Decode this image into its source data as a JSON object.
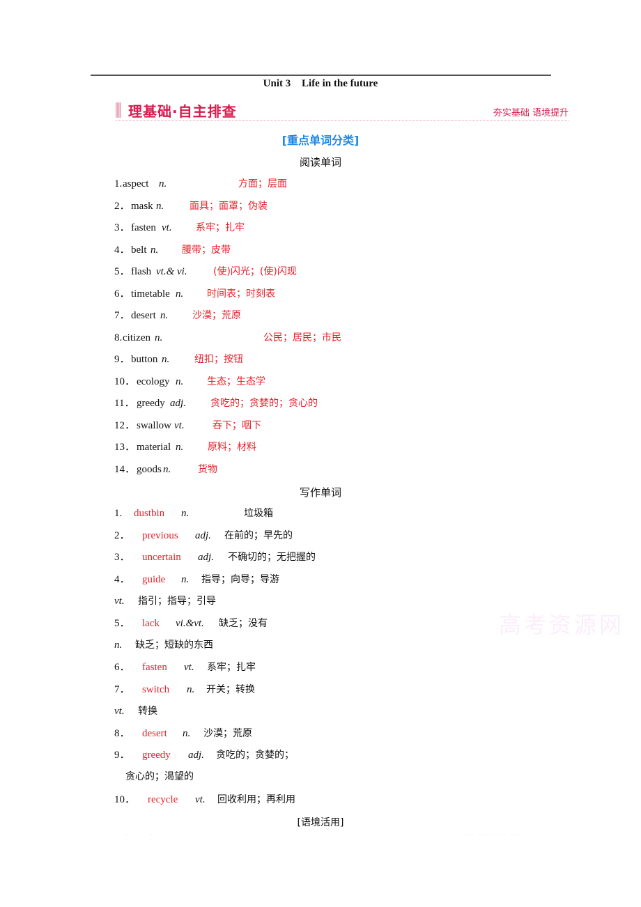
{
  "header": {
    "unit": "Unit 3",
    "title": "Life in the future"
  },
  "section": {
    "title": "理基础·自主排查",
    "tagline": "夯实基础  语境提升"
  },
  "category_title": "[重点单词分类]",
  "reading": {
    "title": "阅读单词",
    "items": [
      {
        "num": "1.",
        "word": "aspect",
        "pos": "n.",
        "meaning": "方面；层面"
      },
      {
        "num": "2．",
        "word": "mask",
        "pos": "n.",
        "meaning": "面具；面罩；伪装"
      },
      {
        "num": "3．",
        "word": "fasten",
        "pos": "vt.",
        "meaning": "系牢；扎牢"
      },
      {
        "num": "4．",
        "word": "belt",
        "pos": "n.",
        "meaning": "腰带；皮带"
      },
      {
        "num": "5．",
        "word": "flash",
        "pos": "vt.& vi.",
        "meaning": "(使)闪光；(使)闪现"
      },
      {
        "num": "6．",
        "word": "timetable",
        "pos": "n.",
        "meaning": "时间表；时刻表"
      },
      {
        "num": "7．",
        "word": "desert",
        "pos": "n.",
        "meaning": "沙漠；荒原"
      },
      {
        "num": "8.",
        "word": "citizen",
        "pos": "n.",
        "meaning": "公民；居民；市民"
      },
      {
        "num": "9．",
        "word": "button",
        "pos": "n.",
        "meaning": "纽扣；按钮"
      },
      {
        "num": "10．",
        "word": "ecology",
        "pos": "n.",
        "meaning": "生态；生态学"
      },
      {
        "num": "11．",
        "word": "greedy",
        "pos": "adj.",
        "meaning": "贪吃的；贪婪的；贪心的"
      },
      {
        "num": "12．",
        "word": "swallow",
        "pos": "vt.",
        "meaning": "吞下；咽下"
      },
      {
        "num": "13．",
        "word": "material",
        "pos": "n.",
        "meaning": "原料；材料"
      },
      {
        "num": "14．",
        "word": "goods",
        "pos": "n.",
        "meaning": "货物"
      }
    ]
  },
  "writing": {
    "title": "写作单词",
    "items": [
      {
        "num": "1.",
        "word": "dustbin",
        "pos": "n.",
        "meaning": "垃圾箱"
      },
      {
        "num": "2．",
        "word": "previous",
        "pos": "adj.",
        "meaning": "在前的；早先的"
      },
      {
        "num": "3．",
        "word": "uncertain",
        "pos": "adj.",
        "meaning": "不确切的；无把握的"
      },
      {
        "num": "4．",
        "word": "guide",
        "pos": "n.",
        "meaning": "指导；向导；导游"
      },
      {
        "num": "",
        "word": "",
        "pos": "vt.",
        "meaning": "指引；指导；引导"
      },
      {
        "num": "5．",
        "word": "lack",
        "pos": "vi.&vt.",
        "meaning": "缺乏；没有"
      },
      {
        "num": "",
        "word": "",
        "pos": "n.",
        "meaning": "缺乏；短缺的东西"
      },
      {
        "num": "6．",
        "word": "fasten",
        "pos": "vt.",
        "meaning": "系牢；扎牢"
      },
      {
        "num": "7．",
        "word": "switch",
        "pos": "n.",
        "meaning": "开关；转换"
      },
      {
        "num": "",
        "word": "",
        "pos": "vt.",
        "meaning": "转换"
      },
      {
        "num": "8．",
        "word": "desert",
        "pos": "n.",
        "meaning": "沙漠；荒原"
      },
      {
        "num": "9．",
        "word": "greedy",
        "pos": "adj.",
        "meaning": "贪吃的；贪婪的；"
      },
      {
        "num": "",
        "word": "",
        "pos": "",
        "meaning": "贪心的；渴望的"
      },
      {
        "num": "10．",
        "word": "recycle",
        "pos": "vt.",
        "meaning": "回收利用；再利用"
      }
    ]
  },
  "context_title": "[语境活用]",
  "watermark": "高考资源网",
  "colors": {
    "answer_red": "#e8202a",
    "section_pink": "#d81b4e",
    "category_blue": "#1e88e5"
  }
}
